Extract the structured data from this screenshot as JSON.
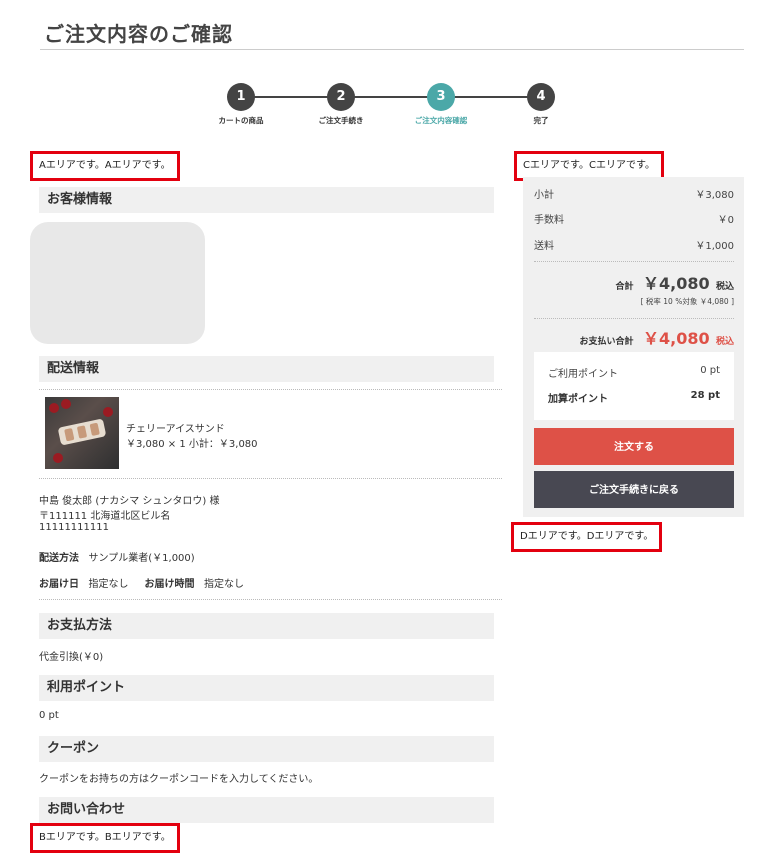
{
  "page": {
    "title": "ご注文内容のご確認"
  },
  "steps": [
    {
      "num": "1",
      "label": "カートの商品"
    },
    {
      "num": "2",
      "label": "ご注文手続き"
    },
    {
      "num": "3",
      "label": "ご注文内容確認"
    },
    {
      "num": "4",
      "label": "完了"
    }
  ],
  "areas": {
    "a": "Aエリアです。Aエリアです。",
    "b": "Bエリアです。Bエリアです。",
    "c": "Cエリアです。Cエリアです。",
    "d": "Dエリアです。Dエリアです。"
  },
  "customer": {
    "heading": "お客様情報"
  },
  "delivery": {
    "heading": "配送情報",
    "product_name": "チェリーアイスサンド",
    "product_price": "￥3,080 × 1  小計：￥3,080",
    "recipient": "中島 俊太郎 (ナカシマ シュンタロウ) 様",
    "address": "〒111111 北海道北区ビル名",
    "phone": "11111111111",
    "method_label": "配送方法",
    "method_value": "サンプル業者(￥1,000)",
    "date_label": "お届け日",
    "date_value": "指定なし",
    "time_label": "お届け時間",
    "time_value": "指定なし"
  },
  "payment": {
    "heading": "お支払方法",
    "value": "代金引換(￥0)"
  },
  "points_section": {
    "heading": "利用ポイント",
    "value": "0 pt"
  },
  "coupon": {
    "heading": "クーポン",
    "value": "クーポンをお持ちの方はクーポンコードを入力してください。"
  },
  "inquiry": {
    "heading": "お問い合わせ"
  },
  "summary": {
    "subtotal_label": "小計",
    "subtotal_value": "￥3,080",
    "fee_label": "手数料",
    "fee_value": "￥0",
    "shipping_label": "送料",
    "shipping_value": "￥1,000",
    "total_label": "合計",
    "total_value": "￥4,080",
    "tax_label": "税込",
    "tax_note": "[ 税率 10 %対象  ￥4,080 ]",
    "payment_label": "お支払い合計",
    "payment_value": "￥4,080",
    "payment_tax": "税込",
    "use_points_label": "ご利用ポイント",
    "use_points_value": "0 pt",
    "add_points_label": "加算ポイント",
    "add_points_value": "28 pt",
    "order_button": "注文する",
    "back_button": "ご注文手続きに戻る"
  },
  "colors": {
    "accent_teal": "#4ba8a8",
    "order_red": "#de5147",
    "dark_button": "#484852",
    "area_border": "#e3000f"
  },
  "icons": {
    "product": "product-thumbnail"
  }
}
